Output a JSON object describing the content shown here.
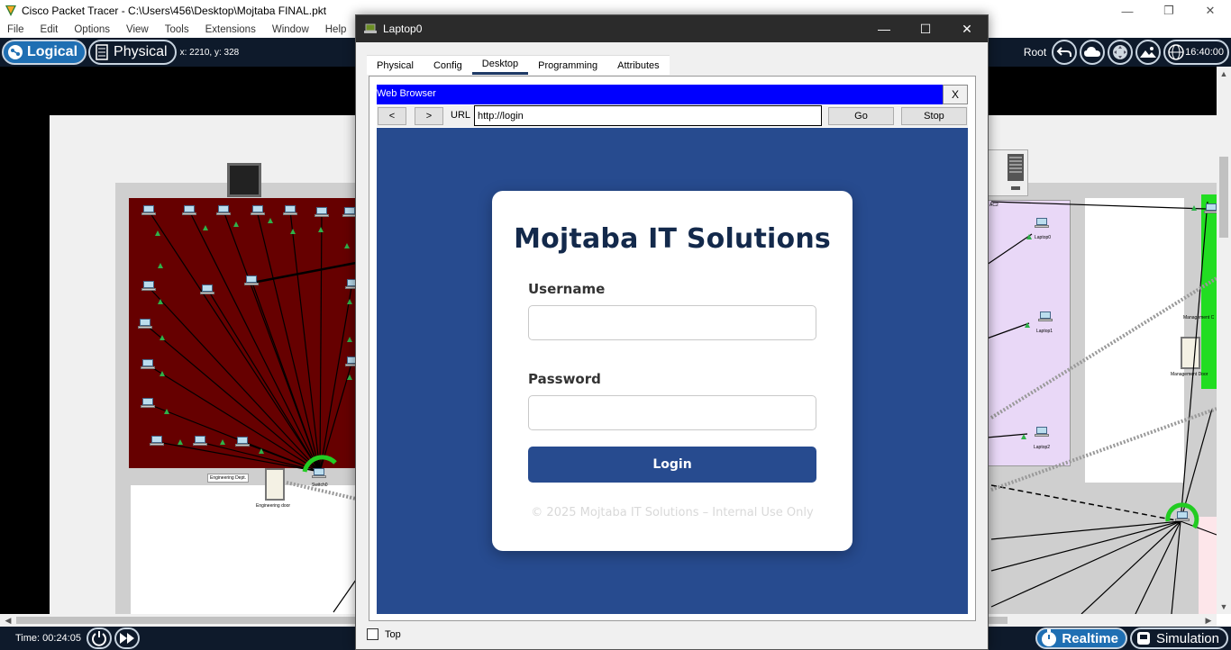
{
  "app": {
    "title": "Cisco Packet Tracer - C:\\Users\\456\\Desktop\\Mojtaba FINAL.pkt",
    "menu": [
      "File",
      "Edit",
      "Options",
      "View",
      "Tools",
      "Extensions",
      "Window",
      "Help"
    ],
    "mode_logical": "Logical",
    "mode_physical": "Physical",
    "coords": "x: 2210, y: 328",
    "root_label": "Root",
    "clock": "16:40:00",
    "time": "Time: 00:24:05",
    "realtime": "Realtime",
    "simulation": "Simulation"
  },
  "workspace": {
    "labels": {
      "eng_dept": "Engineering Dept.",
      "switch0": "Switch0",
      "eng_door": "Engineering door",
      "ac2": "AC2",
      "laptop0": "Laptop0",
      "laptop1": "Laptop1",
      "laptop2": "Laptop2",
      "mgmt_c": "Management C",
      "mgmt_door": "Management Door"
    }
  },
  "dialog": {
    "title": "Laptop0",
    "tabs": [
      "Physical",
      "Config",
      "Desktop",
      "Programming",
      "Attributes"
    ],
    "active_tab": "Desktop",
    "browser": {
      "title": "Web Browser",
      "close": "X",
      "back": "<",
      "forward": ">",
      "url_label": "URL",
      "url": "http://login",
      "go": "Go",
      "stop": "Stop"
    },
    "page": {
      "heading": "Mojtaba IT Solutions",
      "username_label": "Username",
      "username_value": "",
      "password_label": "Password",
      "password_value": "",
      "login_button": "Login",
      "footer": "© 2025 Mojtaba IT Solutions – Internal Use Only"
    },
    "top_checkbox": "Top"
  },
  "colors": {
    "browser_bar": "#0000ff",
    "page_bg": "#274b8f",
    "heading": "#13294b",
    "button": "#274b8f",
    "toolbar": "#0e1a2b",
    "mode_active": "#1f6fb3"
  }
}
